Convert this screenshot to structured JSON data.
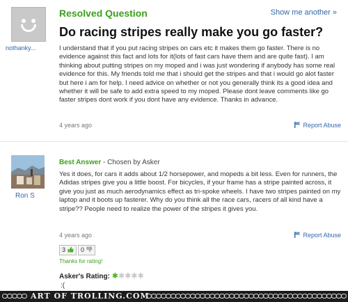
{
  "question": {
    "status": "Resolved Question",
    "show_more": "Show me another »",
    "asker": "nothanky...",
    "title": "Do racing stripes really make you go faster?",
    "body": "I understand that if you put racing stripes on cars etc it makes them go faster. There is no evidence against this fact and lots for it(lots of fast cars have them and are quite fast). I am thinking about putting stripes on my moped and i was just wondering if anybody has some real evidence for this. My friends told me that i should get the stripes and that i would go alot faster but here i am for help. I need advice on whether or not you generally think its a good idea and whether it will be safe to add extra speed to my moped. Please dont leave comments like go faster stripes dont work if you dont have any evidence. Thanks in advance.",
    "time": "4 years ago",
    "report": "Report Abuse"
  },
  "answer": {
    "label": "Best Answer",
    "chosen_by": " - Chosen by Asker",
    "answerer": "Ron S",
    "body": "Yes it does, for cars it adds about 1/2 horsepower, and mopeds a bit less. Even for runners, the Adidas stripes give you a little boost. For bicycles, if your frame has a stripe painted across, it give you just as much aerodynamics effect as tri-spoke wheels. I have two stripes painted on my laptop and it boots up fasterer. Why do you think all the race cars, racers of all kind have a stripe?? People need to realize the power of the stripes it gives you.",
    "time": "4 years ago",
    "report": "Report Abuse",
    "thumbs_up": "3",
    "thumbs_down": "0",
    "thanks": "Thanks for rating!",
    "askers_rating_label": "Asker's Rating:",
    "askers_rating_value": 1,
    "askers_rating_max": 5,
    "askers_comment": ":("
  },
  "banner": {
    "text": "ART OF TROLLING.COM"
  },
  "colors": {
    "green": "#3ca01b",
    "link": "#3366aa",
    "banner_bg": "#1c1c1c"
  }
}
